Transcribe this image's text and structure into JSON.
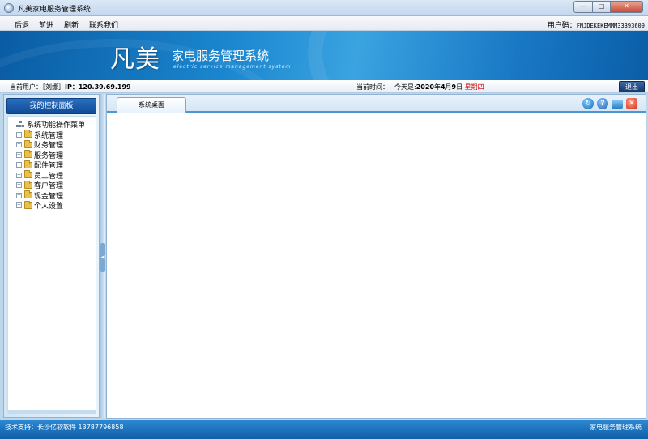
{
  "window": {
    "title": "凡美家电服务管理系统",
    "minimize_glyph": "—",
    "maximize_glyph": "□",
    "close_glyph": "✕"
  },
  "menubar": {
    "items": [
      "后退",
      "前进",
      "刷新",
      "联系我们"
    ],
    "user_code_label": "用户码：",
    "user_code_value": "FNJDEKEKEMMM33393609"
  },
  "banner": {
    "logo_big": "凡美",
    "logo_sub": "家电服务管理系统",
    "logo_en": "electric service management system"
  },
  "infobar": {
    "user_label": "当前用户：［刘娜］",
    "ip_label": "IP：",
    "ip_value": "120.39.69.199",
    "time_label": "当前时间：",
    "date_prefix": "今天是:",
    "year": "2020",
    "year_suffix": "年",
    "month": "4",
    "month_suffix": "月",
    "day": "9",
    "day_suffix": "日",
    "weekday": "星期四",
    "exit_label": "退出"
  },
  "leftpanel": {
    "header": "我的控制面板",
    "root": "系统功能操作菜单",
    "items": [
      "系统管理",
      "财务管理",
      "服务管理",
      "配件管理",
      "员工管理",
      "客户管理",
      "现金管理",
      "个人设置"
    ],
    "expander_glyph": "+"
  },
  "main": {
    "tab_label": "系统桌面",
    "tools": {
      "refresh_glyph": "↻",
      "help_glyph": "?",
      "close_glyph": "✕"
    }
  },
  "footer": {
    "support": "技术支持：长沙亿软软件  13787796858",
    "sys_name": "家电服务管理系统"
  },
  "colors": {
    "banner": "#1a86cf",
    "panel_header": "#0e4b94",
    "footer": "#0f5ea8",
    "weekday": "#d00000"
  }
}
